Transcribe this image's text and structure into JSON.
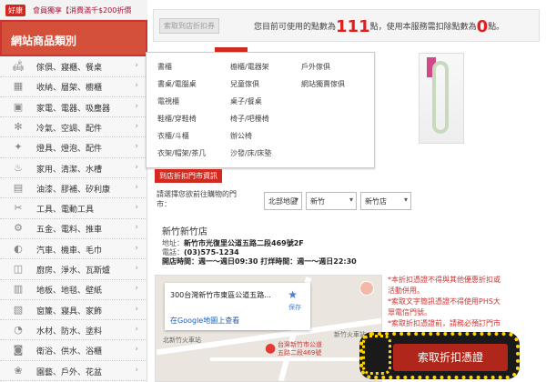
{
  "promo": {
    "badge": "好康",
    "text": "會員獨享【消費滿千$200折價"
  },
  "sidebar": {
    "title": "網站商品類別",
    "items": [
      {
        "label": "傢俱、寢櫃、餐桌",
        "icon": "sofa-icon"
      },
      {
        "label": "收納、層架、櫥櫃",
        "icon": "cabinet-icon"
      },
      {
        "label": "家電、電器、吸塵器",
        "icon": "appliance-icon"
      },
      {
        "label": "冷氣、空調、配件",
        "icon": "fan-icon"
      },
      {
        "label": "燈具、燈泡、配件",
        "icon": "lamp-icon"
      },
      {
        "label": "家用、清潔、水槽",
        "icon": "bucket-icon"
      },
      {
        "label": "油漆、膠補、矽利康",
        "icon": "paint-icon"
      },
      {
        "label": "工具、電動工具",
        "icon": "tool-icon"
      },
      {
        "label": "五金、電料、推車",
        "icon": "hardware-icon"
      },
      {
        "label": "汽車、機車、毛巾",
        "icon": "car-icon"
      },
      {
        "label": "廚房、淨水、瓦斯爐",
        "icon": "kitchen-icon"
      },
      {
        "label": "地板、地毯、壁紙",
        "icon": "floor-icon"
      },
      {
        "label": "窗簾、寢具、家飾",
        "icon": "curtain-icon"
      },
      {
        "label": "水材、防水、塗料",
        "icon": "water-icon"
      },
      {
        "label": "衛浴、供水、浴櫃",
        "icon": "bath-icon"
      },
      {
        "label": "園藝、戶外、花盆",
        "icon": "garden-icon"
      }
    ]
  },
  "points": {
    "tag": "索取到店折扣券",
    "text_a": "您目前可使用的點數為",
    "value": "111",
    "text_b": "點，使用本服務需扣除點數為",
    "cost": "0",
    "text_c": "點。"
  },
  "menu": {
    "col1": [
      "書櫃",
      "書桌/電腦桌",
      "電視櫃",
      "鞋櫃/穿鞋椅",
      "衣櫃/斗櫃",
      "衣架/帽架/茶几"
    ],
    "col2": [
      "櫥櫃/電器架",
      "兒童傢俱",
      "桌子/餐桌",
      "椅子/吧檯椅",
      "辦公椅",
      "沙發/床/床墊"
    ],
    "col3": [
      "戶外傢俱",
      "網站獨賣傢俱"
    ]
  },
  "store": {
    "tag": "到店折扣門市資訊",
    "prompt": "請選擇您欲前往購物的門市：",
    "region": "北部地區",
    "city": "新竹",
    "branch": "新竹店",
    "name": "新竹新竹店",
    "address_label": "地址：",
    "address": "新竹市光復里公道五路二段469號2F",
    "phone_label": "電話：",
    "phone": "(03)575-1234",
    "hours": "開店時間：週一～週日09:30 打烊時間：週一～週日22:30"
  },
  "map": {
    "address": "300台灣新竹市東區公道五路...",
    "save": "保存",
    "link": "在Google地圖上查看",
    "pin_label": "台灣新竹市公道\n五路二段469號",
    "labels": [
      "北新竹火車站",
      "新竹火車站"
    ]
  },
  "notes": [
    "*本折扣憑證不得與其他優惠折扣或",
    "活動併用。",
    "*索取文字簡訊憑證不得使用PHS大",
    "眾電信門號。",
    "*索取折扣憑證前，請務必預訂門市"
  ],
  "discount_button": "索取折扣憑證",
  "colors": {
    "accent": "#d32a1f",
    "highlight": "#ffd400"
  }
}
